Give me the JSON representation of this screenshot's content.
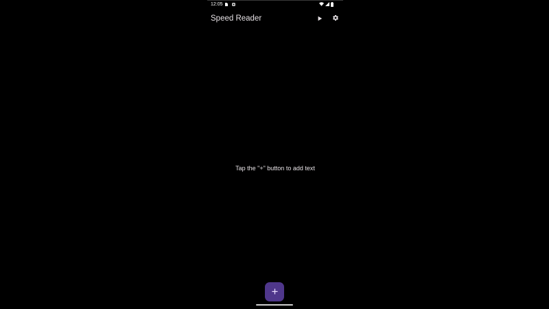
{
  "status_bar": {
    "time": "12:05",
    "icons": [
      "sim-card-icon",
      "notification-icon",
      "wifi-icon",
      "cell-signal-icon",
      "battery-icon"
    ]
  },
  "app_bar": {
    "title": "Speed Reader",
    "actions": [
      "play-icon",
      "settings-gear-icon"
    ]
  },
  "main": {
    "empty_message": "Tap the \"+\" button to add text"
  },
  "fab": {
    "icon": "add-icon",
    "color": "#4f378b"
  },
  "colors": {
    "background": "#000000",
    "on_surface": "#e6e1e5",
    "accent": "#4f378b"
  }
}
